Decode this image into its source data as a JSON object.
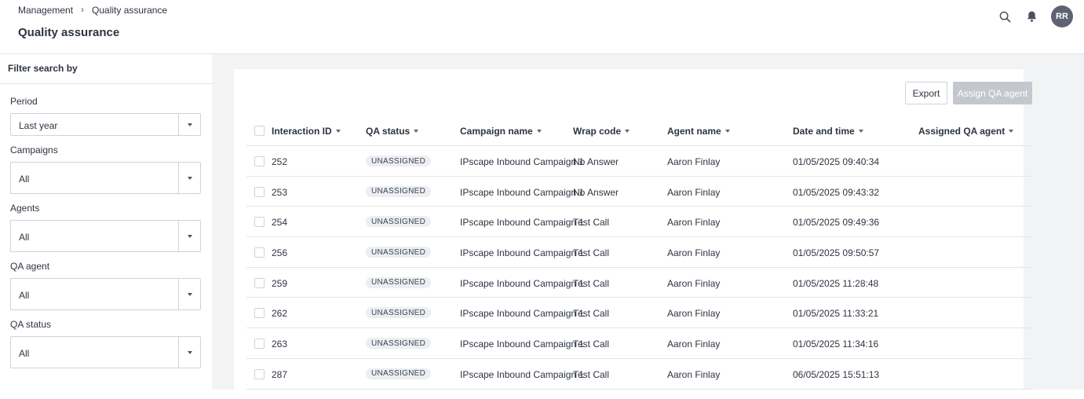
{
  "header": {
    "breadcrumb": [
      "Management",
      "Quality assurance"
    ],
    "breadcrumb_sep": "›",
    "title": "Quality assurance",
    "avatar_initials": "RR",
    "icons": [
      "search-icon",
      "bell-icon"
    ]
  },
  "sidebar": {
    "title": "Filter search by",
    "filters": [
      {
        "label": "Period",
        "value": "Last year"
      },
      {
        "label": "Campaigns",
        "value": "All"
      },
      {
        "label": "Agents",
        "value": "All"
      },
      {
        "label": "QA agent",
        "value": "All"
      },
      {
        "label": "QA status",
        "value": "All"
      }
    ]
  },
  "toolbar": {
    "export_label": "Export",
    "assign_label": "Assign QA agent"
  },
  "table": {
    "columns": [
      "Interaction ID",
      "QA status",
      "Campaign name",
      "Wrap code",
      "Agent name",
      "Date and time",
      "Assigned QA agent"
    ],
    "rows": [
      {
        "id": "252",
        "status": "UNASSIGNED",
        "campaign": "IPscape Inbound Campaign 1",
        "wrap": "No Answer",
        "agent": "Aaron Finlay",
        "datetime": "01/05/2025 09:40:34",
        "qa_agent": ""
      },
      {
        "id": "253",
        "status": "UNASSIGNED",
        "campaign": "IPscape Inbound Campaign 1",
        "wrap": "No Answer",
        "agent": "Aaron Finlay",
        "datetime": "01/05/2025 09:43:32",
        "qa_agent": ""
      },
      {
        "id": "254",
        "status": "UNASSIGNED",
        "campaign": "IPscape Inbound Campaign 1",
        "wrap": "Test Call",
        "agent": "Aaron Finlay",
        "datetime": "01/05/2025 09:49:36",
        "qa_agent": ""
      },
      {
        "id": "256",
        "status": "UNASSIGNED",
        "campaign": "IPscape Inbound Campaign 1",
        "wrap": "Test Call",
        "agent": "Aaron Finlay",
        "datetime": "01/05/2025 09:50:57",
        "qa_agent": ""
      },
      {
        "id": "259",
        "status": "UNASSIGNED",
        "campaign": "IPscape Inbound Campaign 1",
        "wrap": "Test Call",
        "agent": "Aaron Finlay",
        "datetime": "01/05/2025 11:28:48",
        "qa_agent": ""
      },
      {
        "id": "262",
        "status": "UNASSIGNED",
        "campaign": "IPscape Inbound Campaign 1",
        "wrap": "Test Call",
        "agent": "Aaron Finlay",
        "datetime": "01/05/2025 11:33:21",
        "qa_agent": ""
      },
      {
        "id": "263",
        "status": "UNASSIGNED",
        "campaign": "IPscape Inbound Campaign 1",
        "wrap": "Test Call",
        "agent": "Aaron Finlay",
        "datetime": "01/05/2025 11:34:16",
        "qa_agent": ""
      },
      {
        "id": "287",
        "status": "UNASSIGNED",
        "campaign": "IPscape Inbound Campaign 1",
        "wrap": "Test Call",
        "agent": "Aaron Finlay",
        "datetime": "06/05/2025 15:51:13",
        "qa_agent": ""
      }
    ]
  },
  "colors": {
    "accent_disabled": "#c4c8ce",
    "avatar_bg": "#5d6370",
    "badge_bg": "#eceef1",
    "main_bg": "#f2f3f5"
  }
}
